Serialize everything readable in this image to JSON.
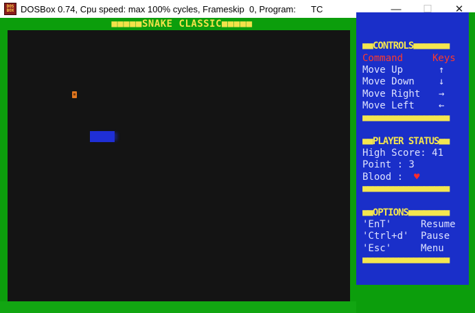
{
  "window": {
    "icon_text": "DOS BOX",
    "title": "DOSBox 0.74, Cpu speed: max 100% cycles, Frameskip  0, Program:",
    "program": "TC",
    "min_glyph": "—",
    "max_glyph": "☐",
    "close_glyph": "✕"
  },
  "game": {
    "title": "■■■■■SNAKE CLASSIC■■■■■"
  },
  "panel": {
    "controls_header": "■■CONTROLS■■■■■■■",
    "command_label": "Command",
    "keys_label": "Keys",
    "controls": [
      {
        "label": "Move Up",
        "key": "↑"
      },
      {
        "label": "Move Down",
        "key": "↓"
      },
      {
        "label": "Move Right",
        "key": "→"
      },
      {
        "label": "Move Left",
        "key": "←"
      }
    ],
    "divider": "■■■■■■■■■■■■■■■■■",
    "status_header": "■■PLAYER STATUS■■",
    "high_score": "High Score: 41",
    "point": "Point : 3",
    "blood_label": "Blood : ",
    "blood_icon": "♥",
    "options_header": "■■OPTIONS■■■■■■■■",
    "options": [
      {
        "key": "'EnT'",
        "action": "Resume"
      },
      {
        "key": "'Ctrl+d'",
        "action": "Pause"
      },
      {
        "key": "'Esc'",
        "action": "Menu"
      }
    ],
    "divider2": "■■■■■■■■■■■■■■■■■",
    "divider3": "■■■■■■■■■■■■■■■■■"
  },
  "colors": {
    "border_green": "#0c9e0c",
    "panel_blue": "#1a2fc9",
    "header_yellow": "#f4e64f",
    "command_red": "#ff3a2a",
    "snake_blue": "#1f2fd6",
    "food_orange": "#e0761f"
  }
}
